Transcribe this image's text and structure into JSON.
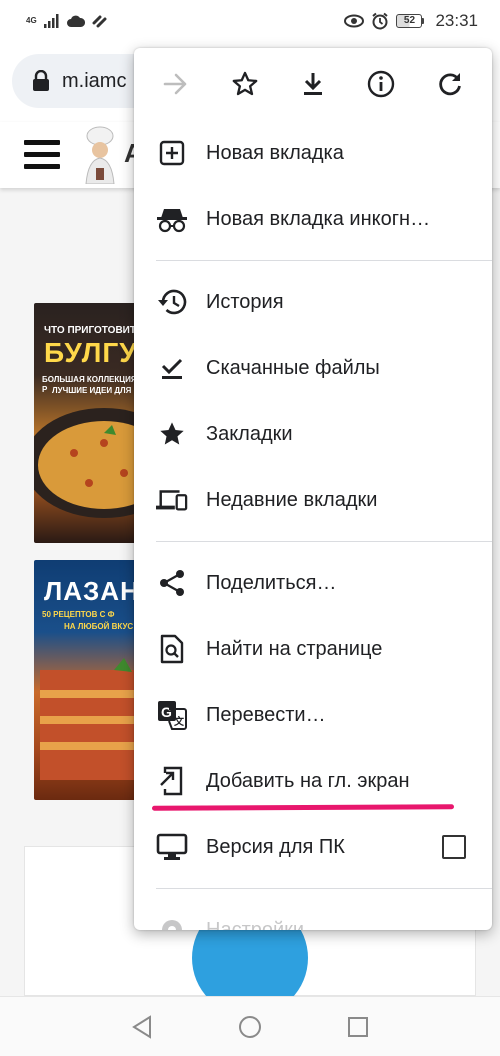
{
  "status_bar": {
    "network": "4G",
    "battery": "52",
    "time": "23:31"
  },
  "url_bar": {
    "url": "m.iamc"
  },
  "page": {
    "site_initial": "A",
    "card1": {
      "line1": "ЧТО ПРИГОТОВИТЬ",
      "line2": "БУЛГУР",
      "line3": "БОЛЬШАЯ КОЛЛЕКЦИЯ Р",
      "line4": "ЛУЧШИЕ ИДЕИ ДЛЯ В"
    },
    "card2": {
      "line1": "ЛАЗАН",
      "line2": "50 РЕЦЕПТОВ С Ф",
      "line3": "НА ЛЮБОЙ ВКУС"
    }
  },
  "menu": {
    "toolbar": [
      {
        "name": "forward-icon"
      },
      {
        "name": "star-icon"
      },
      {
        "name": "download-icon"
      },
      {
        "name": "info-icon"
      },
      {
        "name": "refresh-icon"
      }
    ],
    "items": [
      {
        "label": "Новая вкладка",
        "icon": "new-tab-icon"
      },
      {
        "label": "Новая вкладка инкогн…",
        "icon": "incognito-icon"
      },
      {
        "label": "История",
        "icon": "history-icon"
      },
      {
        "label": "Скачанные файлы",
        "icon": "downloads-check-icon"
      },
      {
        "label": "Закладки",
        "icon": "bookmarks-star-icon"
      },
      {
        "label": "Недавние вкладки",
        "icon": "recent-tabs-icon"
      },
      {
        "label": "Поделиться…",
        "icon": "share-icon"
      },
      {
        "label": "Найти на странице",
        "icon": "find-in-page-icon"
      },
      {
        "label": "Перевести…",
        "icon": "translate-icon"
      },
      {
        "label": "Добавить на гл. экран",
        "icon": "add-to-home-icon"
      },
      {
        "label": "Версия для ПК",
        "icon": "desktop-icon",
        "checked": false
      },
      {
        "label": "Настройки",
        "icon": "settings-icon"
      }
    ]
  },
  "colors": {
    "annotation_underline": "#e8176d",
    "telegram_blue": "#2ea0df"
  }
}
